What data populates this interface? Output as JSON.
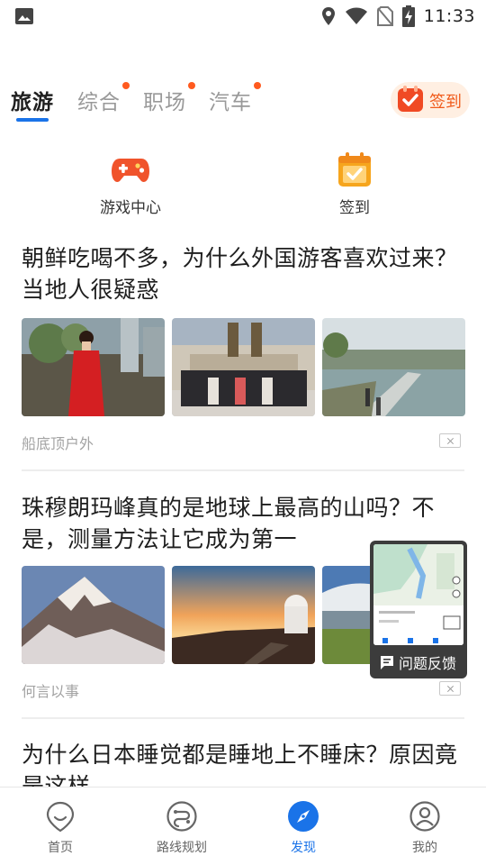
{
  "status_bar": {
    "time": "11:33",
    "icons": [
      "photo-icon",
      "location-icon",
      "wifi-icon",
      "no-sim-icon",
      "battery-charging-icon"
    ]
  },
  "tabs": [
    {
      "label": "旅游",
      "active": true,
      "dot": false
    },
    {
      "label": "综合",
      "active": false,
      "dot": true
    },
    {
      "label": "职场",
      "active": false,
      "dot": true
    },
    {
      "label": "汽车",
      "active": false,
      "dot": true
    }
  ],
  "signin_button": {
    "label": "签到",
    "icon": "calendar-check-icon"
  },
  "shortcuts": [
    {
      "label": "游戏中心",
      "icon": "gamepad-icon"
    },
    {
      "label": "签到",
      "icon": "calendar-check-icon"
    }
  ],
  "articles": [
    {
      "title": "朝鲜吃喝不多，为什么外国游客喜欢过来？当地人很疑惑",
      "source": "船底顶户外",
      "images": [
        "woman-in-red-coat-photo",
        "group-at-monument-photo",
        "riverside-bridge-photo"
      ]
    },
    {
      "title": "珠穆朗玛峰真的是地球上最高的山吗？不是，测量方法让它成为第一",
      "source": "何言以事",
      "images": [
        "snowy-mountain-photo",
        "observatory-sunset-photo",
        "lake-landscape-photo"
      ]
    },
    {
      "title": "为什么日本睡觉都是睡地上不睡床？原因竟是这样"
    }
  ],
  "feedback": {
    "label": "问题反馈"
  },
  "bottom_nav": [
    {
      "label": "首页",
      "icon": "home-icon",
      "active": false
    },
    {
      "label": "路线规划",
      "icon": "route-icon",
      "active": false
    },
    {
      "label": "发现",
      "icon": "compass-icon",
      "active": true
    },
    {
      "label": "我的",
      "icon": "profile-icon",
      "active": false
    }
  ],
  "colors": {
    "accent": "#1a73e8",
    "badge": "#ff5a1f",
    "signin_bg": "#ffefe2",
    "signin_text": "#f05a1a"
  }
}
